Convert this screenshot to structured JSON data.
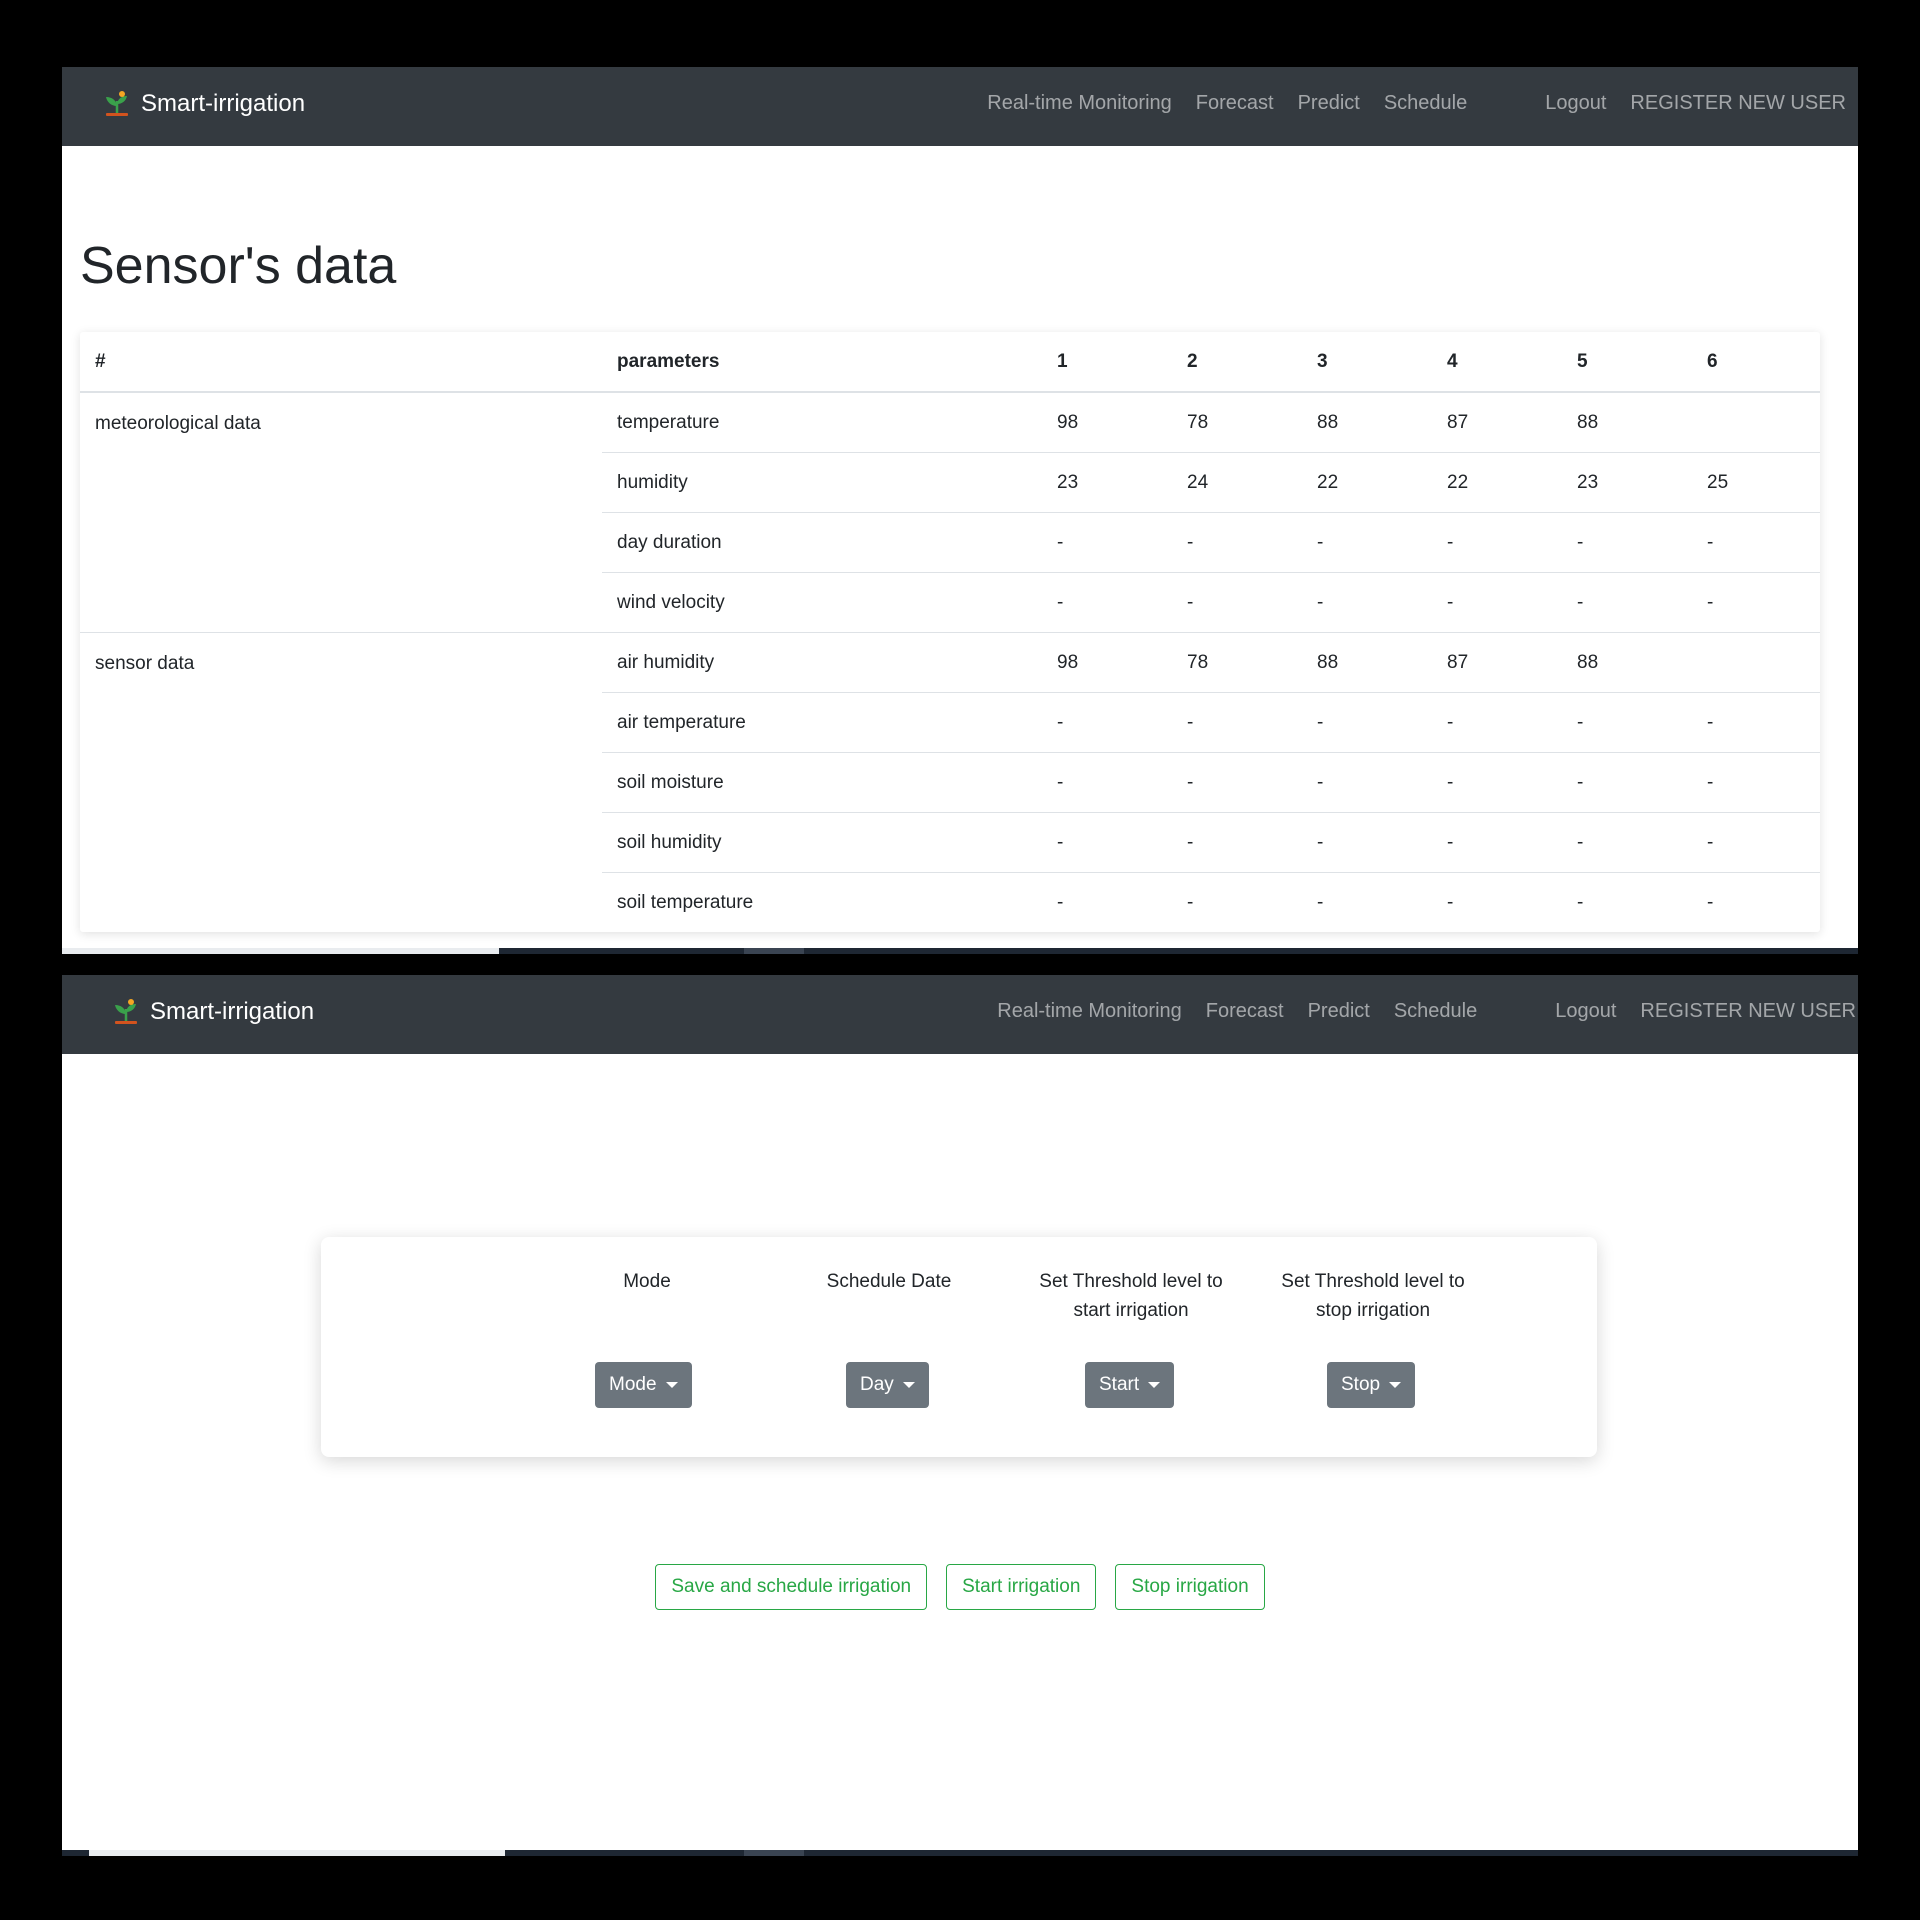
{
  "app": {
    "brand": "Smart-irrigation",
    "nav": [
      "Real-time Monitoring",
      "Forecast",
      "Predict",
      "Schedule",
      "Logout",
      "REGISTER NEW USER"
    ]
  },
  "sensor_page": {
    "title": "Sensor's data",
    "table": {
      "headers": [
        "#",
        "parameters",
        "1",
        "2",
        "3",
        "4",
        "5",
        "6"
      ],
      "groups": [
        "meteorological data",
        "sensor data"
      ],
      "rows": [
        {
          "param": "temperature",
          "values": [
            "98",
            "78",
            "88",
            "87",
            "88",
            ""
          ]
        },
        {
          "param": "humidity",
          "values": [
            "23",
            "24",
            "22",
            "22",
            "23",
            "25"
          ]
        },
        {
          "param": "day duration",
          "values": [
            "-",
            "-",
            "-",
            "-",
            "-",
            "-"
          ]
        },
        {
          "param": "wind velocity",
          "values": [
            "-",
            "-",
            "-",
            "-",
            "-",
            "-"
          ]
        },
        {
          "param": "air humidity",
          "values": [
            "98",
            "78",
            "88",
            "87",
            "88",
            ""
          ]
        },
        {
          "param": "air temperature",
          "values": [
            "-",
            "-",
            "-",
            "-",
            "-",
            "-"
          ]
        },
        {
          "param": "soil moisture",
          "values": [
            "-",
            "-",
            "-",
            "-",
            "-",
            "-"
          ]
        },
        {
          "param": "soil humidity",
          "values": [
            "-",
            "-",
            "-",
            "-",
            "-",
            "-"
          ]
        },
        {
          "param": "soil temperature",
          "values": [
            "-",
            "-",
            "-",
            "-",
            "-",
            "-"
          ]
        }
      ]
    }
  },
  "schedule_page": {
    "labels": {
      "mode": "Mode",
      "date": "Schedule Date",
      "start_threshold": "Set Threshold level to start irrigation",
      "stop_threshold": "Set Threshold level to stop irrigation"
    },
    "dropdowns": {
      "mode": "Mode",
      "date": "Day",
      "start": "Start",
      "stop": "Stop"
    },
    "actions": {
      "save": "Save and schedule irrigation",
      "start": "Start irrigation",
      "stop": "Stop irrigation"
    }
  },
  "colors": {
    "navbar": "#343a40",
    "dropdown": "#6c757d",
    "success": "#28a745",
    "brand_leaf": "#3aa14b",
    "brand_flower": "#f5a623",
    "brand_pot": "#d2531e"
  }
}
